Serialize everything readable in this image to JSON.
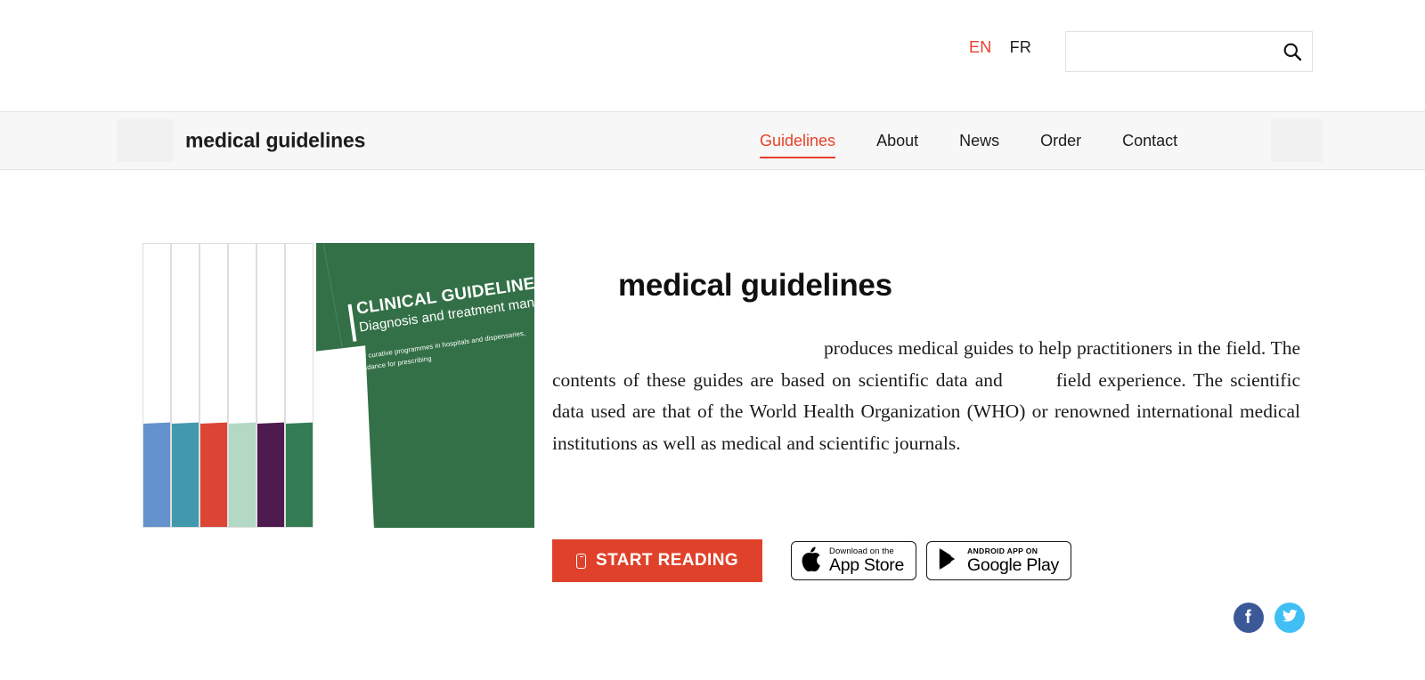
{
  "header": {
    "languages": [
      {
        "code": "EN",
        "active": true
      },
      {
        "code": "FR",
        "active": false
      }
    ],
    "search": {
      "value": "",
      "placeholder": "",
      "icon": "search-icon"
    }
  },
  "nav": {
    "brand": "medical guidelines",
    "items": [
      {
        "label": "Guidelines",
        "active": true
      },
      {
        "label": "About",
        "active": false
      },
      {
        "label": "News",
        "active": false
      },
      {
        "label": "Order",
        "active": false
      },
      {
        "label": "Contact",
        "active": false
      }
    ],
    "active_color": "#e8412a"
  },
  "hero": {
    "book": {
      "cover_title": "CLINICAL GUIDELINES",
      "cover_subtitle": "Diagnosis and treatment manual",
      "cover_note_line1": "For curative programmes in hospitals and dispensaries,",
      "cover_note_line2": "guidance for prescribing",
      "cover_color": "#337047",
      "spine_colors": [
        "#6392cd",
        "#4299ad",
        "#dc4535",
        "#b3d8c4",
        "#4d1b4f",
        "#337c54"
      ]
    },
    "headline": "medical guidelines",
    "paragraph_part1": "produces medical guides to help practitioners in the field. The contents of these guides are based on scientific data and",
    "paragraph_part2": "field experience. The scientific data used are that of the World Health Organization (WHO) or renowned international medical institutions as well as medical and scientific journals.",
    "start_button": {
      "label": "START READING",
      "icon": "device-icon",
      "color": "#e0412a"
    },
    "badges": [
      {
        "id": "app-store",
        "small": "Download on the",
        "big": "App Store",
        "icon": "apple-icon"
      },
      {
        "id": "google-play",
        "small": "ANDROID APP ON",
        "big": "Google Play",
        "icon": "google-play-icon"
      }
    ],
    "social": [
      {
        "id": "facebook",
        "icon": "facebook-icon",
        "color": "#3b5998"
      },
      {
        "id": "twitter",
        "icon": "twitter-icon",
        "color": "#40bff5"
      }
    ]
  }
}
